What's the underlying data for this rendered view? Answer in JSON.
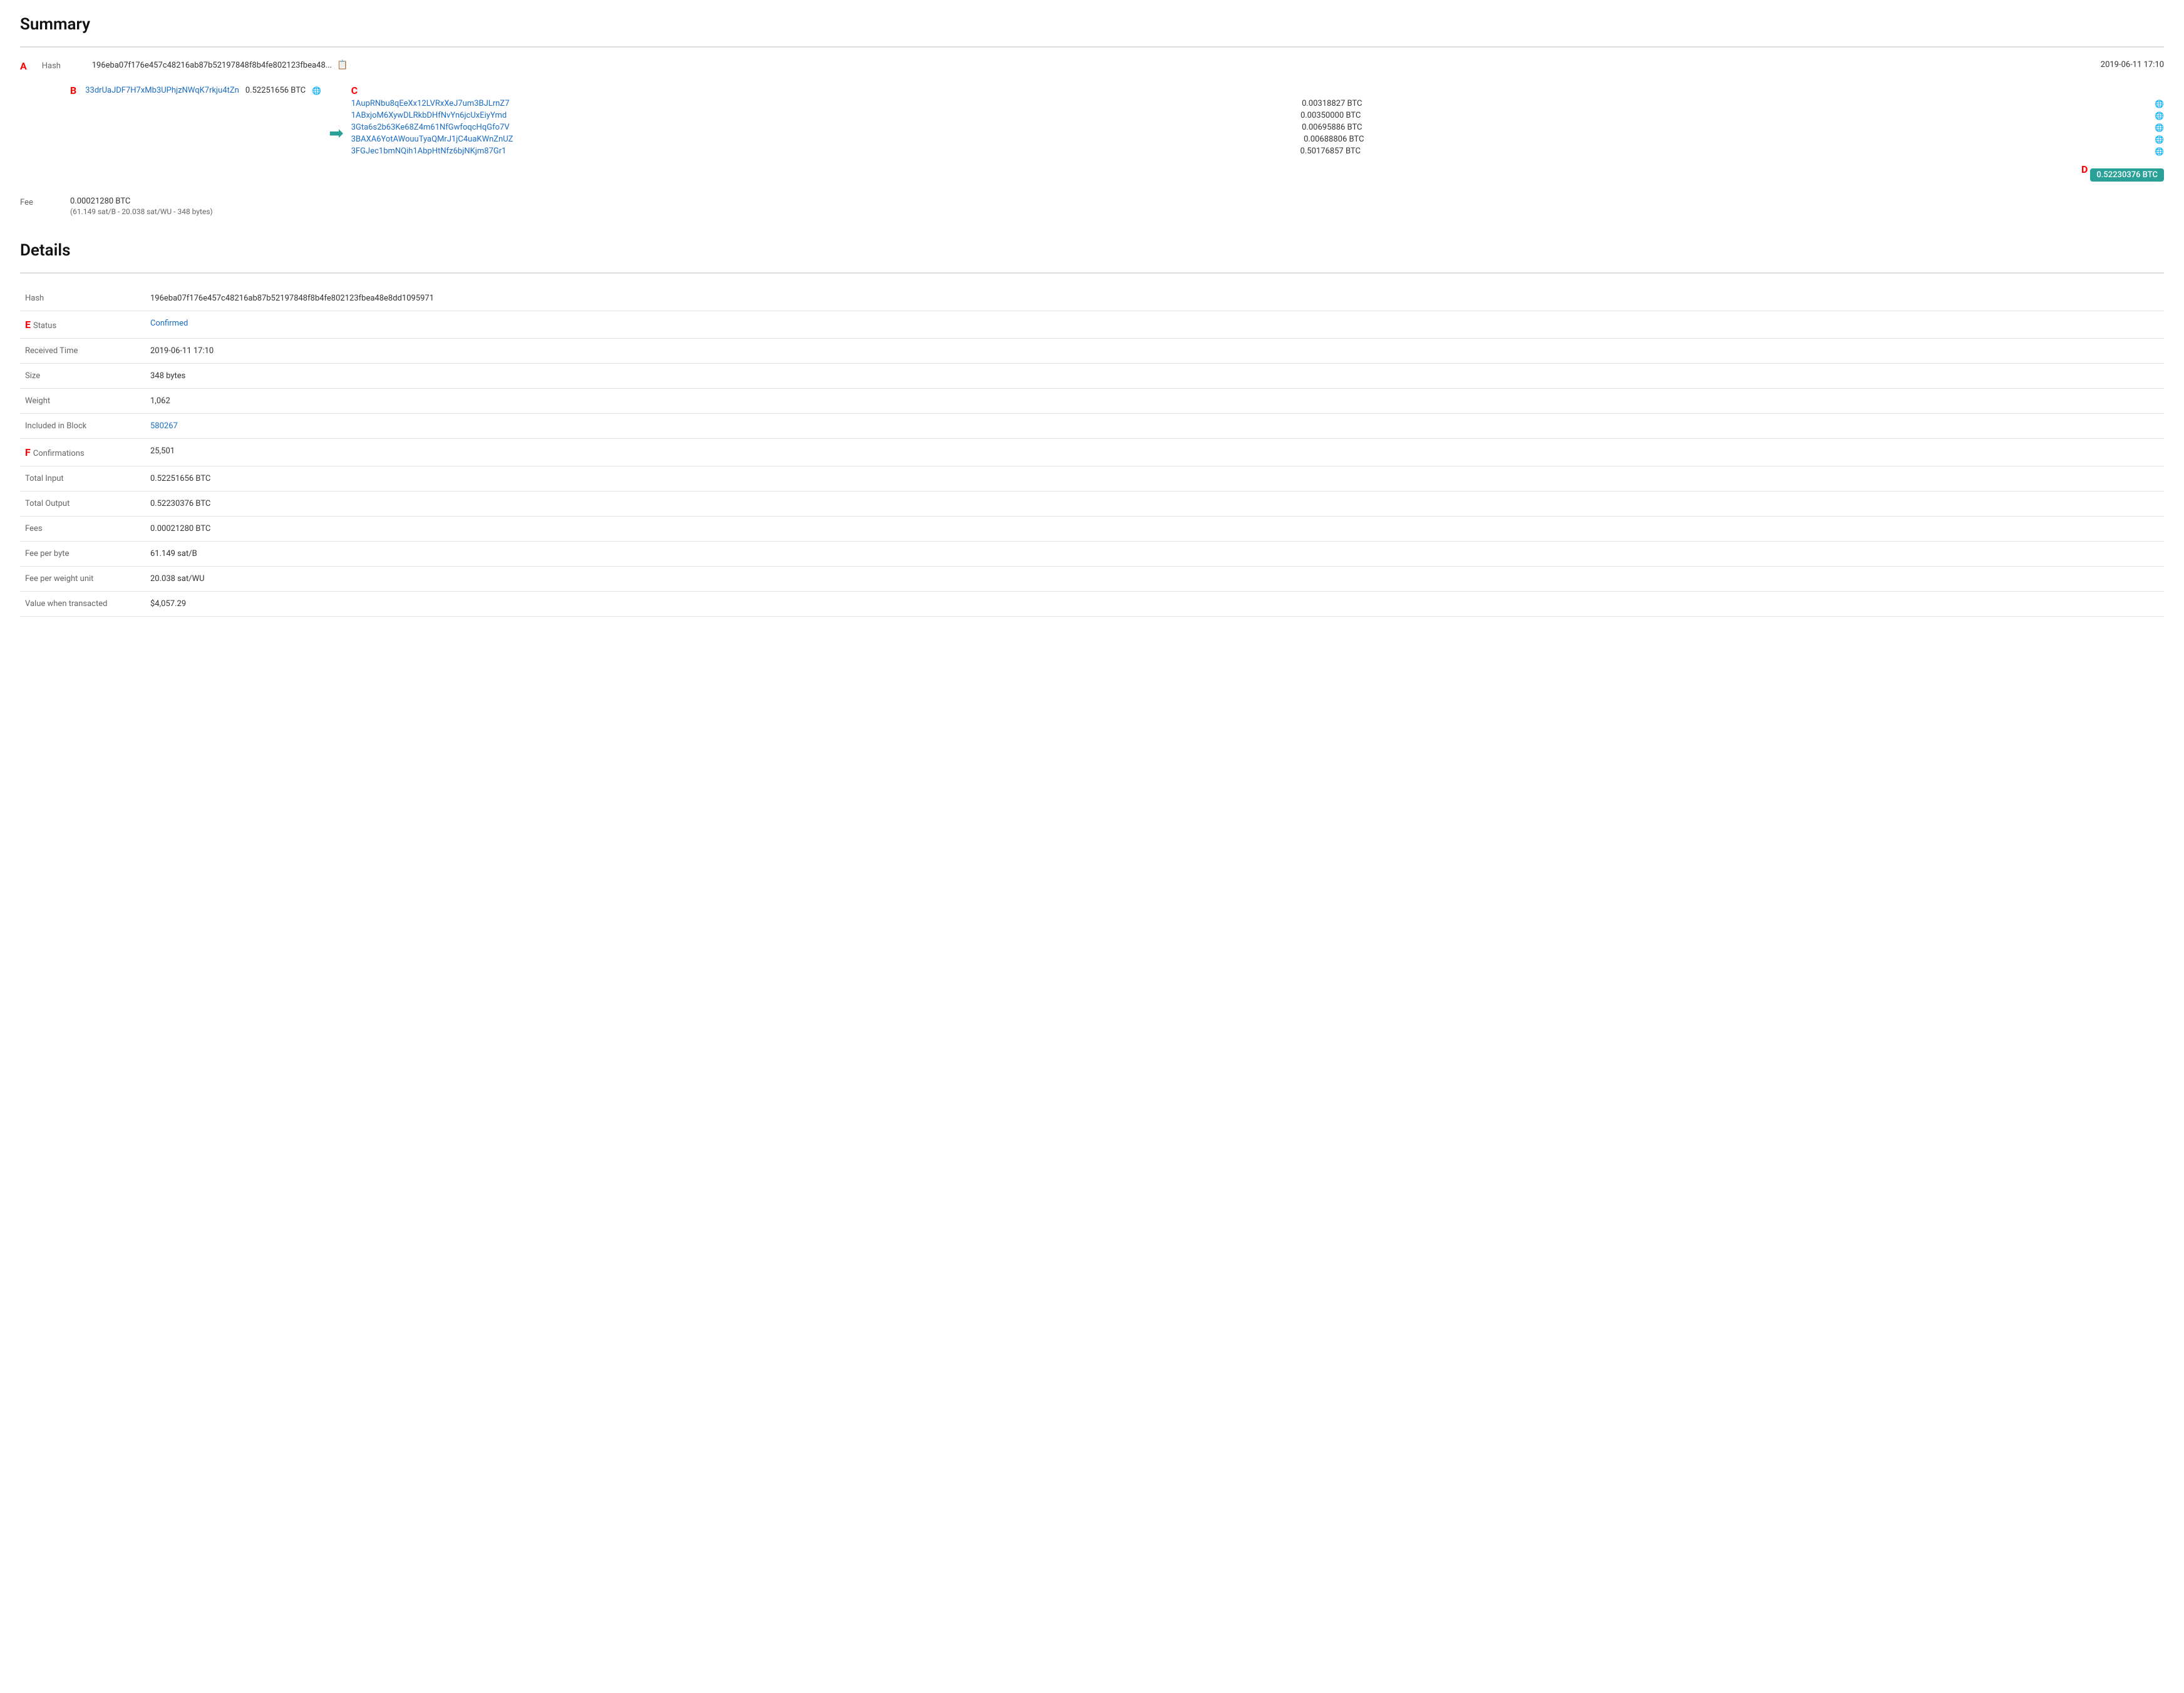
{
  "summary": {
    "title": "Summary",
    "hash_short": "196eba07f176e457c48216ab87b52197848f8b4fe802123fbea48...",
    "hash_full": "196eba07f176e457c48216ab87b52197848f8b4fe802123fbea48e8dd1095971",
    "copy_icon": "📋",
    "timestamp": "2019-06-11 17:10",
    "label_a": "A",
    "label_b": "B",
    "label_c": "C",
    "label_d": "D",
    "label_e": "E",
    "label_f": "F",
    "input_address": "33drUaJDF7H7xMb3UPhjzNWqK7rkju4tZn",
    "input_amount": "0.52251656 BTC",
    "outputs": [
      {
        "address": "1AupRNbu8qEeXx12LVRxXeJ7um3BJLrnZ7",
        "amount": "0.00318827 BTC"
      },
      {
        "address": "1ABxjoM6XywDLRkbDHfNvYn6jcUxEiyYmd",
        "amount": "0.00350000 BTC"
      },
      {
        "address": "3Gta6s2b63Ke68Z4m61NfGwfoqcHqGfo7V",
        "amount": "0.00695886 BTC"
      },
      {
        "address": "3BAXA6YotAWouuTyaQMrJ1jC4uaKWnZnUZ",
        "amount": "0.00688806 BTC"
      },
      {
        "address": "3FGJec1bmNQih1AbpHtNfz6bjNKjm87Gr1",
        "amount": "0.50176857 BTC"
      }
    ],
    "total_output_badge": "0.52230376 BTC",
    "fee_label": "Fee",
    "fee_main": "0.00021280 BTC",
    "fee_sub": "(61.149 sat/B - 20.038 sat/WU - 348 bytes)"
  },
  "details": {
    "title": "Details",
    "rows": [
      {
        "label": "Hash",
        "value": "196eba07f176e457c48216ab87b52197848f8b4fe802123fbea48e8dd1095971",
        "type": "text"
      },
      {
        "label": "Status",
        "value": "Confirmed",
        "type": "status"
      },
      {
        "label": "Received Time",
        "value": "2019-06-11 17:10",
        "type": "text"
      },
      {
        "label": "Size",
        "value": "348 bytes",
        "type": "text"
      },
      {
        "label": "Weight",
        "value": "1,062",
        "type": "text"
      },
      {
        "label": "Included in Block",
        "value": "580267",
        "type": "link"
      },
      {
        "label": "Confirmations",
        "value": "25,501",
        "type": "text"
      },
      {
        "label": "Total Input",
        "value": "0.52251656 BTC",
        "type": "text"
      },
      {
        "label": "Total Output",
        "value": "0.52230376 BTC",
        "type": "text"
      },
      {
        "label": "Fees",
        "value": "0.00021280 BTC",
        "type": "text"
      },
      {
        "label": "Fee per byte",
        "value": "61.149 sat/B",
        "type": "text"
      },
      {
        "label": "Fee per weight unit",
        "value": "20.038 sat/WU",
        "type": "text"
      },
      {
        "label": "Value when transacted",
        "value": "$4,057.29",
        "type": "text"
      }
    ]
  },
  "colors": {
    "accent_blue": "#1a6cc4",
    "accent_teal": "#2aa198",
    "red_label": "#cc0000",
    "text_muted": "#666666",
    "border": "#e5e5e5"
  }
}
